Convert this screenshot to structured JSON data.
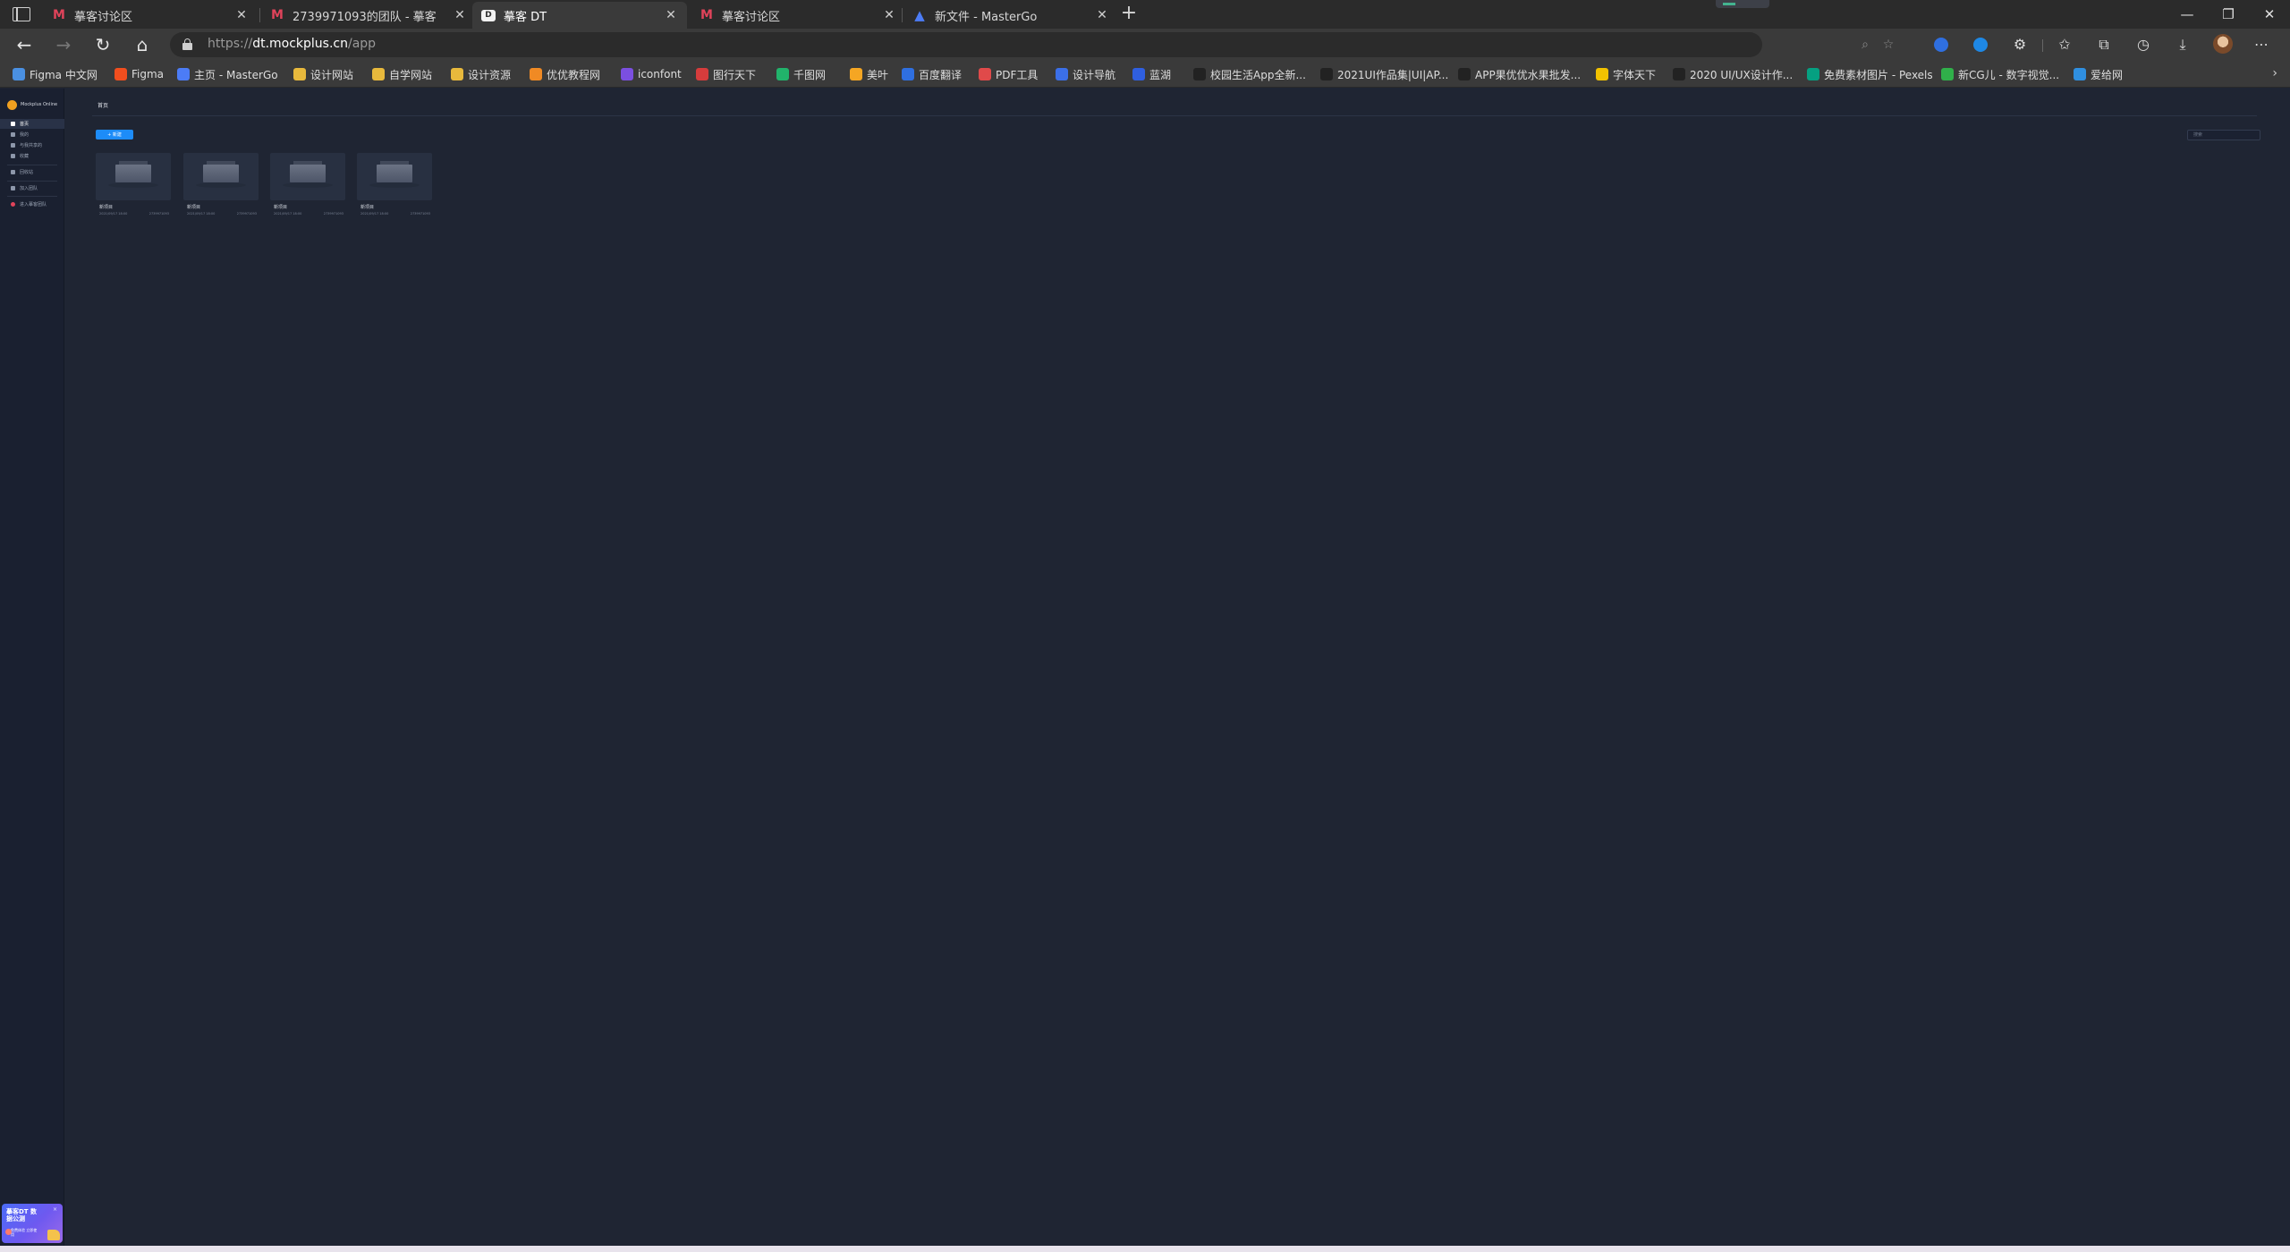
{
  "browser": {
    "tabs": [
      {
        "title": "摹客讨论区",
        "icon": "mockplus-logo-icon",
        "active": false
      },
      {
        "title": "2739971093的团队 - 摹客",
        "icon": "mockplus-logo-icon",
        "active": false
      },
      {
        "title": "摹客 DT",
        "icon": "dt-logo-icon",
        "active": true
      },
      {
        "title": "摹客讨论区",
        "icon": "mockplus-logo-icon",
        "active": false
      },
      {
        "title": "新文件 - MasterGo",
        "icon": "mastergo-logo-icon",
        "active": false
      }
    ],
    "address": {
      "scheme": "https://",
      "host": "dt.mockplus.cn",
      "path": "/app"
    },
    "bookmarks": [
      {
        "label": "Figma 中文网",
        "color": "#4a90e2"
      },
      {
        "label": "Figma",
        "color": "#f24e1e"
      },
      {
        "label": "主页 - MasterGo",
        "color": "#4c7cf6"
      },
      {
        "label": "设计网站",
        "color": "#e8b93c"
      },
      {
        "label": "自学网站",
        "color": "#e8b93c"
      },
      {
        "label": "设计资源",
        "color": "#e8b93c"
      },
      {
        "label": "优优教程网",
        "color": "#f08a24"
      },
      {
        "label": "iconfont",
        "color": "#7b4fe0"
      },
      {
        "label": "图行天下",
        "color": "#d63c3c"
      },
      {
        "label": "千图网",
        "color": "#21b36b"
      },
      {
        "label": "美叶",
        "color": "#f5a623"
      },
      {
        "label": "百度翻译",
        "color": "#2f6fe0"
      },
      {
        "label": "PDF工具",
        "color": "#e04a4a"
      },
      {
        "label": "设计导航",
        "color": "#3b6fe8"
      },
      {
        "label": "蓝湖",
        "color": "#2f5fe0"
      },
      {
        "label": "校园生活App全新...",
        "color": "#222222"
      },
      {
        "label": "2021UI作品集|UI|AP...",
        "color": "#222222"
      },
      {
        "label": "APP果优优水果批发...",
        "color": "#222222"
      },
      {
        "label": "字体天下",
        "color": "#f2c200"
      },
      {
        "label": "2020 UI/UX设计作...",
        "color": "#222222"
      },
      {
        "label": "免费素材图片 - Pexels",
        "color": "#05a081"
      },
      {
        "label": "新CG儿 - 数字视觉...",
        "color": "#30b04a"
      },
      {
        "label": "爱给网",
        "color": "#2f8fe0"
      }
    ]
  },
  "app": {
    "brand": "Mockplus Online",
    "sidebar_items": [
      {
        "label": "首页",
        "active": true
      },
      {
        "label": "我的",
        "active": false
      },
      {
        "label": "与我共享的",
        "active": false
      },
      {
        "label": "收藏",
        "active": false
      },
      {
        "label": "回收站",
        "active": false
      },
      {
        "label": "加入团队",
        "active": false
      },
      {
        "label": "进入摹客团队",
        "active": false
      }
    ],
    "promo": {
      "title": "摹客DT 数据公测",
      "subtitle": "免费体验 立即使用",
      "close": "×"
    },
    "page_title": "首页",
    "new_button": "+ 新建",
    "search_placeholder": "搜索",
    "cards": [
      {
        "name": "新项目",
        "date": "2021/09/17 18:00",
        "owner": "2739971093"
      },
      {
        "name": "新项目",
        "date": "2021/09/17 18:00",
        "owner": "2739971093"
      },
      {
        "name": "新项目",
        "date": "2021/09/17 18:00",
        "owner": "2739971093"
      },
      {
        "name": "新项目",
        "date": "2021/09/17 18:00",
        "owner": "2739971093"
      }
    ]
  }
}
